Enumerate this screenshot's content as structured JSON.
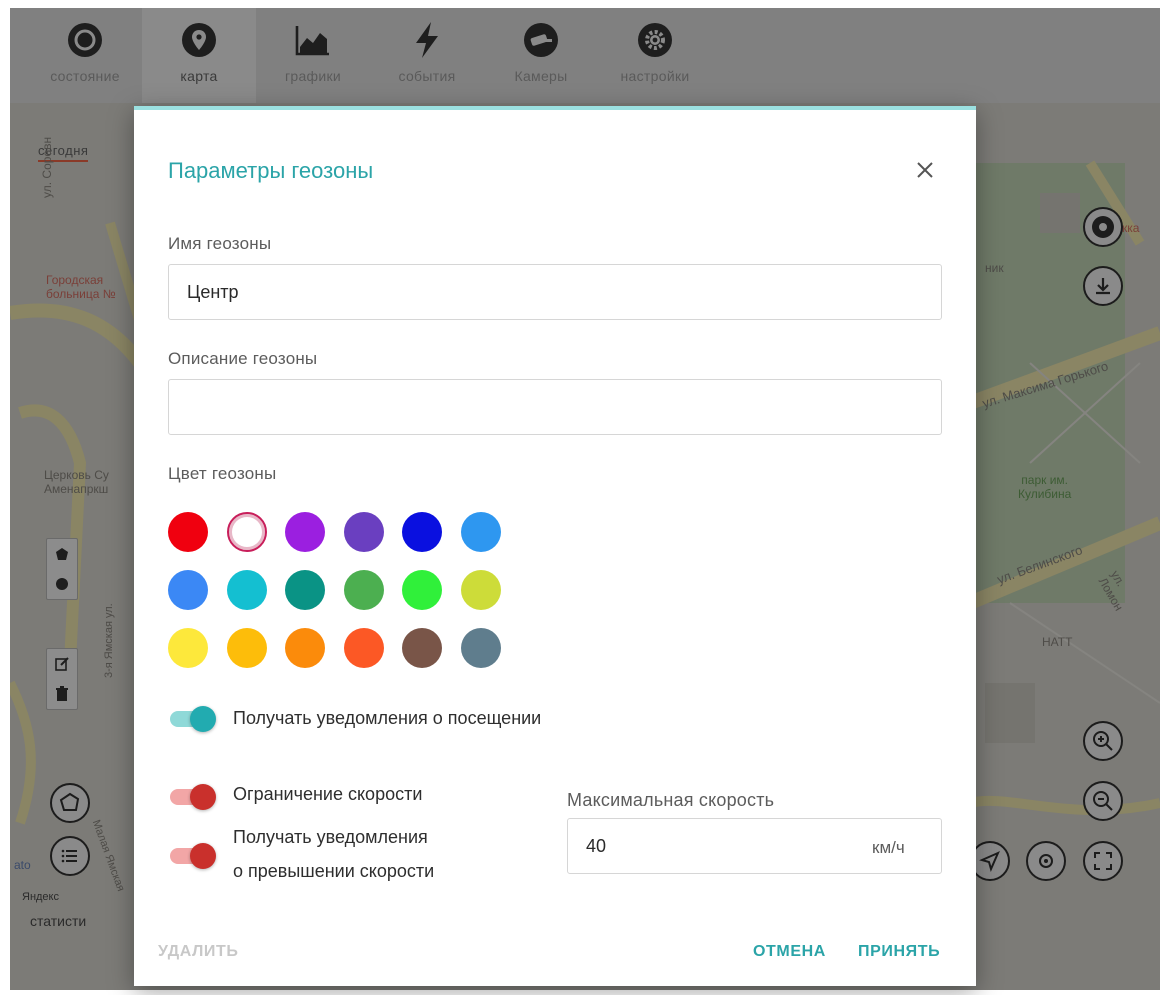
{
  "nav": {
    "tabs": [
      {
        "label": "состояние",
        "icon": "status-circle-icon"
      },
      {
        "label": "карта",
        "icon": "map-pin-icon"
      },
      {
        "label": "графики",
        "icon": "chart-icon"
      },
      {
        "label": "события",
        "icon": "lightning-icon"
      },
      {
        "label": "Камеры",
        "icon": "camera-icon"
      },
      {
        "label": "настройки",
        "icon": "gear-icon"
      }
    ],
    "active_tab": "карта"
  },
  "map": {
    "today_tab": "сегодня",
    "stats_label": "статисти",
    "attribution": "Яндекс",
    "labels": {
      "street_sorev": "ул. Соревн",
      "hospital": "Городская\nбольница №",
      "church": "Церковь Су\nАменапркш",
      "street_maksima_gorkogo": "ул. Максима Горького",
      "park": "парк им.\nКулибина",
      "street_belinskogo": "ул. Белинского",
      "street_lomon": "ул. Ломон",
      "hatt": "НАТТ",
      "street_yamskaya": "3-я Ямская ул.",
      "street_malaya_yamskaya": "Малая Ямская",
      "park_label_small": "ник",
      "kka": "кка",
      "ato": "ato"
    }
  },
  "modal": {
    "title": "Параметры геозоны",
    "name_label": "Имя геозоны",
    "name_value": "Центр",
    "description_label": "Описание геозоны",
    "description_value": "",
    "color_label": "Цвет геозоны",
    "colors": [
      [
        "#f0000f",
        "#ffffff",
        "#9b1fe0",
        "#6a3fc0",
        "#0a10e0",
        "#2e97f0"
      ],
      [
        "#3b88f5",
        "#14bfd1",
        "#0a9385",
        "#4caf50",
        "#30f03a",
        "#cddc39"
      ],
      [
        "#fde83b",
        "#fdbd0a",
        "#fb8b0b",
        "#fc5825",
        "#795548",
        "#5f7d8d"
      ]
    ],
    "selected_color": "#ffffff",
    "notify_visit_label": "Получать уведомления о посещении",
    "notify_visit_on": true,
    "speed_limit_label": "Ограничение скорости",
    "speed_limit_on": true,
    "notify_speed_label_line1": "Получать уведомления",
    "notify_speed_label_line2": "о превышении скорости",
    "notify_speed_on": true,
    "max_speed_label": "Максимальная скорость",
    "max_speed_value": "40",
    "max_speed_unit": "км/ч",
    "delete_label": "УДАЛИТЬ",
    "cancel_label": "ОТМЕНА",
    "accept_label": "ПРИНЯТЬ"
  }
}
